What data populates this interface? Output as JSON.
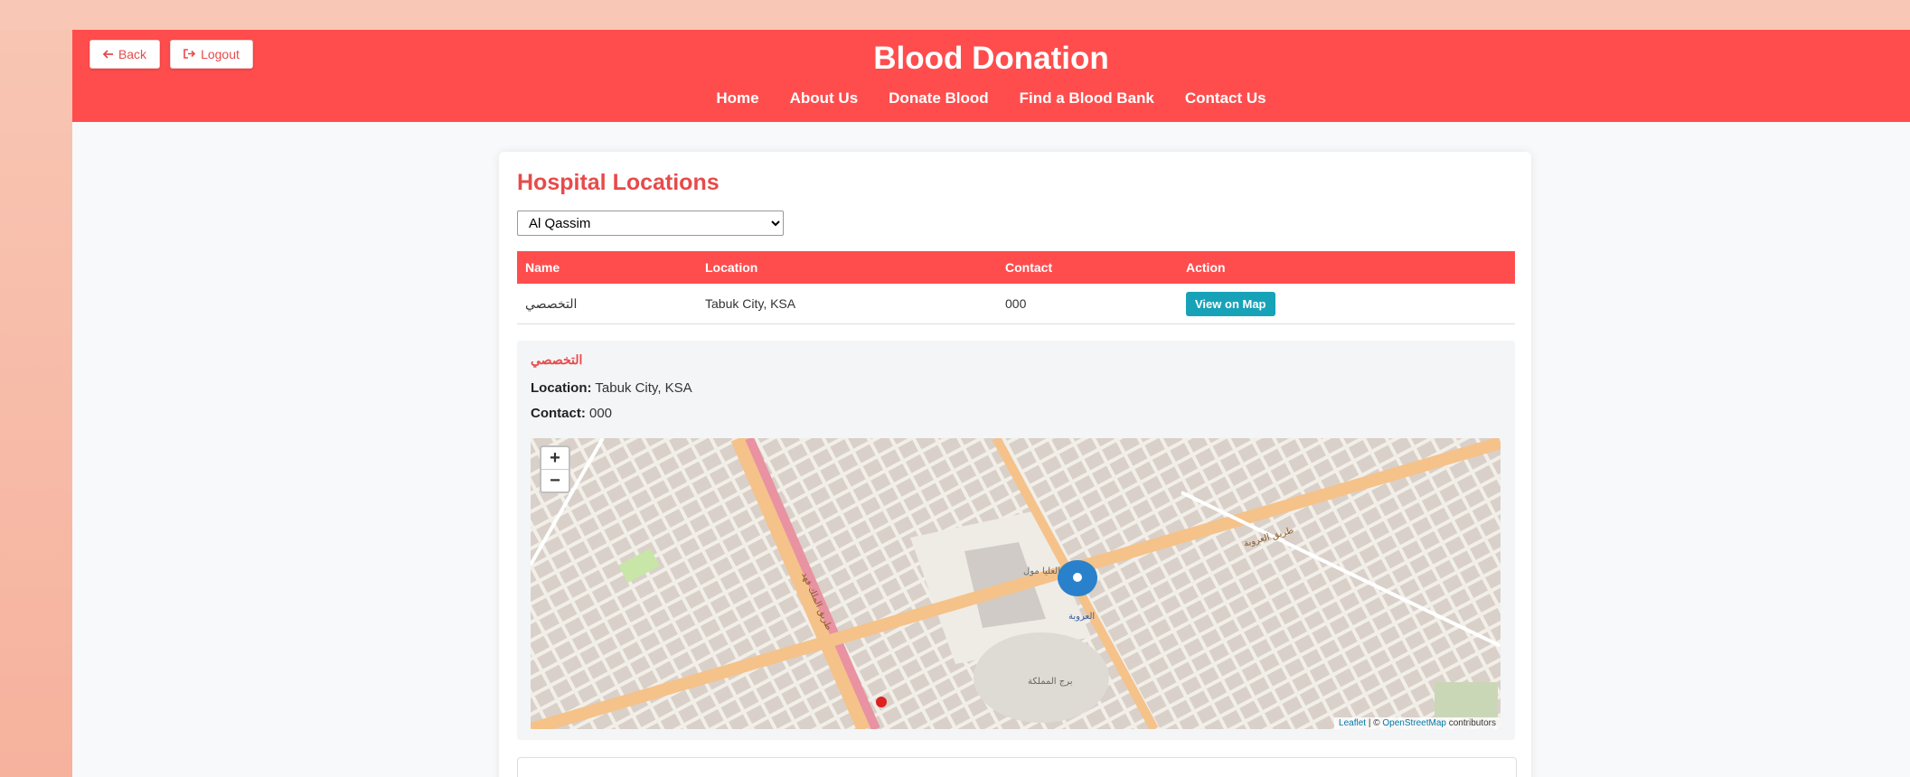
{
  "header": {
    "back_label": "Back",
    "logout_label": "Logout",
    "title": "Blood Donation",
    "nav": [
      "Home",
      "About Us",
      "Donate Blood",
      "Find a Blood Bank",
      "Contact Us"
    ]
  },
  "main": {
    "heading": "Hospital Locations",
    "region_selected": "Al Qassim",
    "table": {
      "headers": [
        "Name",
        "Location",
        "Contact",
        "Action"
      ],
      "rows": [
        {
          "name": "التخصصي",
          "location": "Tabuk City, KSA",
          "contact": "000",
          "action": "View on Map"
        }
      ]
    },
    "detail": {
      "title": "التخصصي",
      "location_label": "Location:",
      "location": "Tabuk City, KSA",
      "contact_label": "Contact:",
      "contact": "000"
    },
    "map": {
      "zoom_in": "+",
      "zoom_out": "−",
      "attribution_leaflet": "Leaflet",
      "attribution_sep": " | © ",
      "attribution_osm": "OpenStreetMap",
      "attribution_suffix": " contributors",
      "labels": [
        "العليا مول",
        "برج المملكة",
        "العروبة",
        "طريق العروبة",
        "طريق الملك فهد"
      ]
    }
  },
  "colors": {
    "brand_red": "#ff4d4d",
    "title_red": "#e84a4a",
    "button_teal": "#17a2b8",
    "marker_blue": "#2a81cb"
  }
}
